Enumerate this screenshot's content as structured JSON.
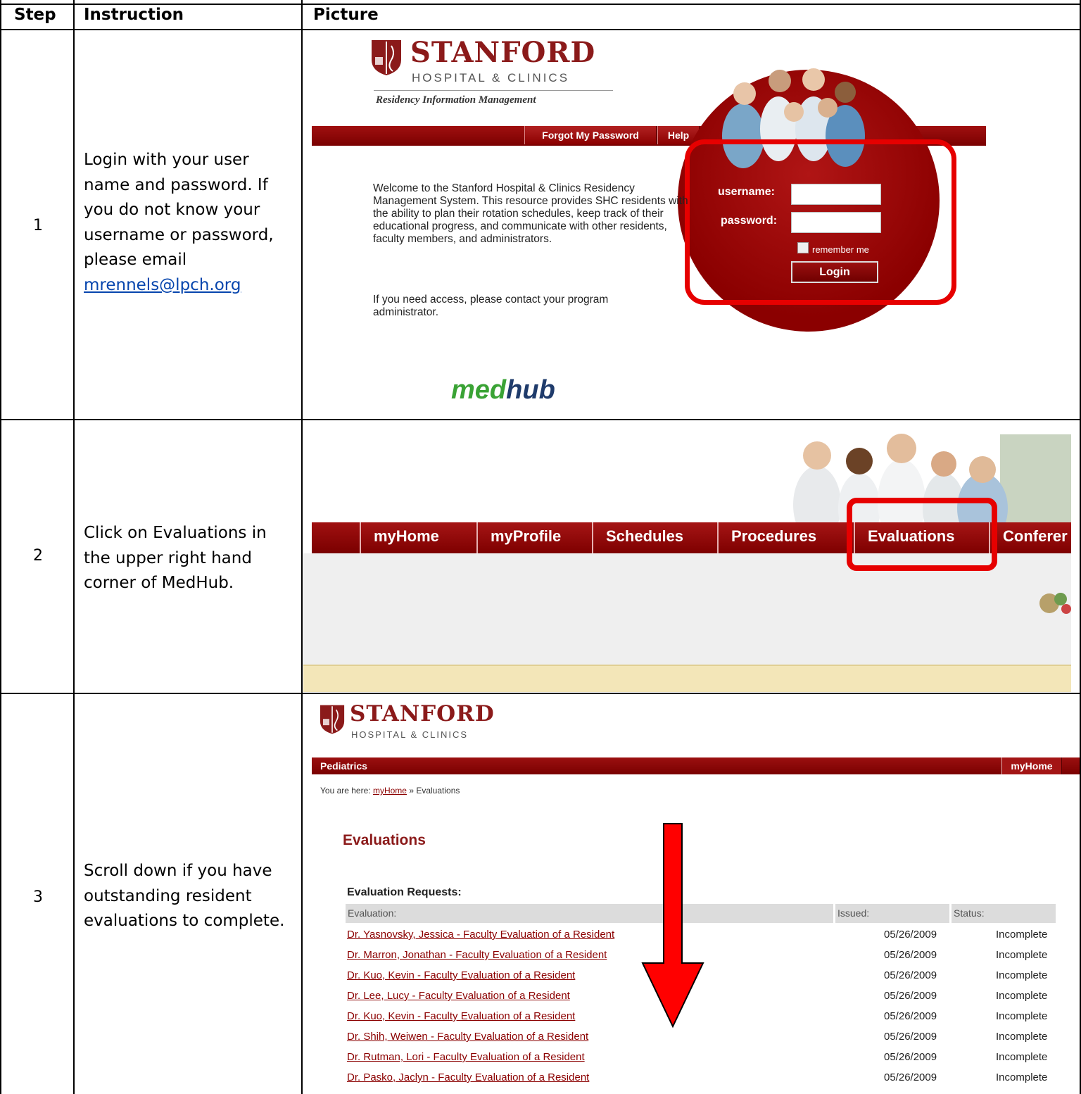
{
  "table": {
    "headers": [
      "Step",
      "Instruction",
      "Picture"
    ],
    "rows": [
      {
        "step": "1",
        "instruction": "Login with your user name and password. If you do not know your username or password, please email",
        "link": "mrennels@lpch.org"
      },
      {
        "step": "2",
        "instruction": "Click on Evaluations in the upper right hand corner of MedHub."
      },
      {
        "step": "3",
        "instruction": "Scroll down if you have outstanding resident evaluations to complete."
      }
    ]
  },
  "login_page": {
    "brand": "STANFORD",
    "subbrand": "HOSPITAL & CLINICS",
    "tagline": "Residency Information Management",
    "nav": [
      "Forgot My Password",
      "Help"
    ],
    "welcome": "Welcome to the Stanford Hospital & Clinics Residency Management System. This resource provides SHC residents with the ability to plan their rotation schedules, keep track of their educational progress, and communicate with other residents, faculty members, and administrators.",
    "access_note": "If you need access, please contact your program administrator.",
    "username_label": "username:",
    "password_label": "password:",
    "remember_label": "remember me",
    "login_button": "Login",
    "logo_med": "med",
    "logo_hub": "hub",
    "colors": {
      "brand_red": "#8b0000",
      "highlight": "#e60000",
      "medhub_green": "#3aa335",
      "medhub_blue": "#1f3b6b"
    }
  },
  "nav_page": {
    "tabs": [
      "myHome",
      "myProfile",
      "Schedules",
      "Procedures",
      "Evaluations",
      "Conferer"
    ]
  },
  "eval_page": {
    "brand": "STANFORD",
    "subbrand": "HOSPITAL & CLINICS",
    "department": "Pediatrics",
    "myhome_button": "myHome",
    "breadcrumb_prefix": "You are here:",
    "breadcrumb_link": "myHome",
    "breadcrumb_current": "» Evaluations",
    "title": "Evaluations",
    "requests_title": "Evaluation Requests:",
    "columns": [
      "Evaluation:",
      "Issued:",
      "Status:"
    ],
    "rows": [
      {
        "evaluation": "Dr. Yasnovsky, Jessica - Faculty Evaluation of a Resident",
        "issued": "05/26/2009",
        "status": "Incomplete"
      },
      {
        "evaluation": "Dr. Marron, Jonathan - Faculty Evaluation of a Resident",
        "issued": "05/26/2009",
        "status": "Incomplete"
      },
      {
        "evaluation": "Dr. Kuo, Kevin - Faculty Evaluation of a Resident",
        "issued": "05/26/2009",
        "status": "Incomplete"
      },
      {
        "evaluation": "Dr. Lee, Lucy - Faculty Evaluation of a Resident",
        "issued": "05/26/2009",
        "status": "Incomplete"
      },
      {
        "evaluation": "Dr. Kuo, Kevin - Faculty Evaluation of a Resident",
        "issued": "05/26/2009",
        "status": "Incomplete"
      },
      {
        "evaluation": "Dr. Shih, Weiwen - Faculty Evaluation of a Resident",
        "issued": "05/26/2009",
        "status": "Incomplete"
      },
      {
        "evaluation": "Dr. Rutman, Lori - Faculty Evaluation of a Resident",
        "issued": "05/26/2009",
        "status": "Incomplete"
      },
      {
        "evaluation": "Dr. Pasko, Jaclyn - Faculty Evaluation of a Resident",
        "issued": "05/26/2009",
        "status": "Incomplete"
      }
    ]
  }
}
